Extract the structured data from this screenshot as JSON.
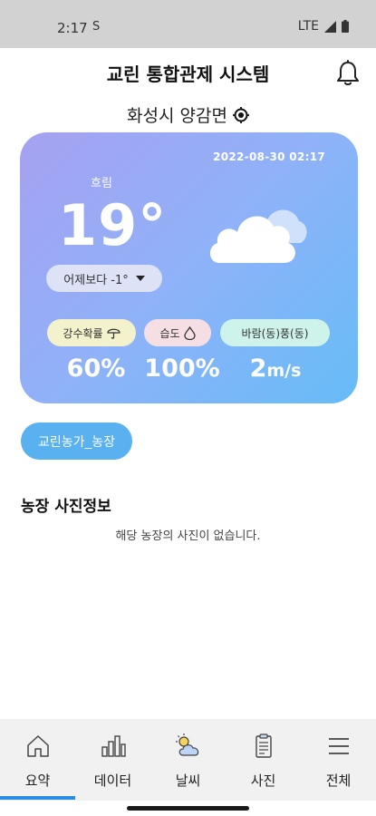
{
  "status_bar": {
    "time": "2:17",
    "carrier_glyph": "S",
    "network": "LTE"
  },
  "header": {
    "title": "교린 통합관제 시스템",
    "bell_icon": "bell-icon"
  },
  "location": {
    "name": "화성시 양감면",
    "icon": "gps-target-icon"
  },
  "weather": {
    "datetime": "2022-08-30 02:17",
    "condition": "흐림",
    "temperature": "19°",
    "compare_label": "어제보다 -1°",
    "rain": {
      "label": "강수확률",
      "value": "60%"
    },
    "humidity": {
      "label": "습도",
      "value": "100%"
    },
    "wind": {
      "label": "바람(동)풍(동)",
      "value_num": "2",
      "value_unit": "m/s"
    },
    "card_gradient": [
      "#a6a1f1",
      "#66bcf7"
    ]
  },
  "farm": {
    "button_label": "교린농가_농장",
    "accent": "#5ab1f0"
  },
  "photos": {
    "section_title": "농장 사진정보",
    "empty_message": "해당 농장의 사진이 없습니다."
  },
  "nav": {
    "items": [
      {
        "label": "요약",
        "icon": "home-icon"
      },
      {
        "label": "데이터",
        "icon": "bar-chart-icon"
      },
      {
        "label": "날씨",
        "icon": "weather-icon"
      },
      {
        "label": "사진",
        "icon": "clipboard-icon"
      },
      {
        "label": "전체",
        "icon": "menu-icon"
      }
    ],
    "active_index": 0,
    "active_color": "#2f8ae3"
  }
}
